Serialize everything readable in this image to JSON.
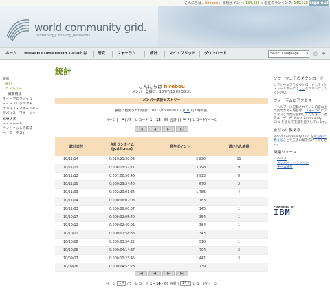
{
  "topbar": {
    "greeting": "こんにちは、",
    "username": "hirobou",
    "sep1": " :: ",
    "points_label": "累積ポイント: ",
    "points": "134,433",
    "sep2": " :: ",
    "rank_label": "現在のランキング: ",
    "rank": "149,528",
    "signout": "sign out"
  },
  "banner": {
    "title": "world community grid.",
    "tagline": "technology solving problems"
  },
  "nav": {
    "items": [
      "ホーム",
      "WORLD COMMUNITY GRIDとは",
      "研究",
      "フォーラム",
      "統計",
      "マイ・グリッド",
      "ダウンロード"
    ],
    "language": "Select Language"
  },
  "page": {
    "heading": "統計"
  },
  "sidebar": {
    "items": [
      {
        "label": "統計",
        "level": 0
      },
      {
        "label": "統計",
        "level": 1
      },
      {
        "label": "ヒストリー",
        "level": 1
      },
      {
        "label": "概要統計",
        "level": 2
      },
      {
        "label": "マイ・プロファイル",
        "level": 0
      },
      {
        "label": "マイ・プロジェクト",
        "level": 0
      },
      {
        "label": "デバイス・マネージャー",
        "level": 0
      },
      {
        "label": "デバイス・マネージャー",
        "level": 0
      },
      {
        "label": "結果状況",
        "level": 0
      },
      {
        "label": "マイ・チーム",
        "level": 0
      },
      {
        "label": "ウィジェットの作成",
        "level": 0
      },
      {
        "label": "ベータ・テスト",
        "level": 0
      }
    ]
  },
  "greeting": {
    "prefix": "こんにちは ",
    "username": "hirobou"
  },
  "member_since": "メンバー登録日：10/07/13 03:56:31",
  "history_title": "メンバー統計ヒストリー",
  "updated": {
    "prefix": "最後に更新された統計：10/11/15 00:06:02 (",
    "utc": "UTC",
    "suffix": ") [3 時間前]"
  },
  "pager": {
    "page_label": "ページ",
    "page_value": "1",
    "of_pages": "/ 5 | レコード",
    "range": "1 - 14",
    "of_records": " - 66 合計 |",
    "per_page_value": "14",
    "per_page_label": "レコード/ページ"
  },
  "nav_buttons": [
    "|◀",
    "◀",
    "▶",
    "▶|"
  ],
  "table": {
    "headers": {
      "date": "統計日付",
      "runtime_title": "合計ランタイム",
      "runtime_unit": "(y:d:h:m:s)",
      "points": "発生ポイント",
      "results": "返された結果"
    },
    "rows": [
      [
        "10/11/14",
        "0:010:21:39:23",
        "5,830",
        "11"
      ],
      [
        "10/11/13",
        "0:006:13:32:11",
        "3,798",
        "9"
      ],
      [
        "10/11/12",
        "0:007:00:56:46",
        "3,913",
        "8"
      ],
      [
        "10/11/10",
        "0:000:23:24:40",
        "679",
        "2"
      ],
      [
        "10/11/09",
        "0:002:20:01:34",
        "1,785",
        "4"
      ],
      [
        "10/11/04",
        "0:000:06:02:03",
        "183",
        "1"
      ],
      [
        "10/11/03",
        "0:000:06:00:37",
        "145",
        "1"
      ],
      [
        "10/10/17",
        "0:000:02:05:40",
        "354",
        "1"
      ],
      [
        "10/10/12",
        "0:000:02:49:01",
        "384",
        "1"
      ],
      [
        "10/10/11",
        "0:000:01:58:33",
        "343",
        "1"
      ],
      [
        "10/10/08",
        "0:000:03:34:22",
        "510",
        "1"
      ],
      [
        "10/10/06",
        "0:000:04:14:37",
        "704",
        "2"
      ],
      [
        "10/09/27",
        "0:000:10:23:45",
        "1,441",
        "3"
      ],
      [
        "10/09/26",
        "0:000:04:53:28",
        "739",
        "1"
      ]
    ]
  },
  "right": {
    "download_title": "ソフトウェアのダウンロード",
    "download_text": "ソフトウェアをダウンロードしてインストールするには",
    "download_link": "ここ",
    "download_text2": "をクリックしてください。",
    "forum_title": "フォーラムにアクセス",
    "forum_text1": "「ヘルプ」に記載されている内容以上の質問がある場合は、",
    "forum_link": "フォーラム",
    "forum_text2": "にアクセスし質問を投稿してください。他のユーザーが World Community Grid を通じて支援を提供しています。",
    "friend_title": "友だちに教える",
    "friend_text1": "World Community Grid を",
    "friend_link": "友だちに教える",
    "friend_text2": "ことで支援の輪を広げてください。",
    "resources_title": "関連リソース",
    "resources": [
      "ヘルプ",
      "メンバー・セクション",
      "チーム統計"
    ],
    "powered_by": "POWERED BY",
    "ibm": "IBM"
  }
}
